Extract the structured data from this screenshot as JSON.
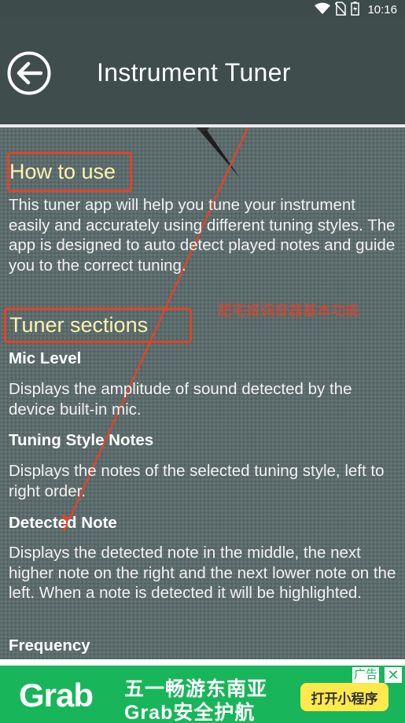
{
  "status_bar": {
    "time": "10:16"
  },
  "header": {
    "title": "Instrument Tuner",
    "back_icon": "back-arrow-icon"
  },
  "content": {
    "how_to_use_title": "How to use",
    "how_to_use_text": "This tuner app will help you tune your instrument easily and accurately using different tuning styles. The app is designed to auto detect played notes and guide you to the correct tuning.",
    "tuner_sections_title": "Tuner sections",
    "annotation": "肥宅姬调音器基本功能",
    "sections": [
      {
        "label": "Mic Level",
        "text": "Displays the amplitude of sound detected by the device built-in mic."
      },
      {
        "label": "Tuning Style Notes",
        "text": "Displays the notes of the selected tuning style, left to right order."
      },
      {
        "label": "Detected Note",
        "text": "Displays the detected note in the middle, the next higher note on the right and the next lower note on the left. When a note is detected it will be highlighted."
      },
      {
        "label": "Frequency",
        "text": ""
      }
    ]
  },
  "ad": {
    "brand": "Grab",
    "line1": "五一畅游东南亚",
    "line2": "Grab安全护航",
    "cta": "打开小程序",
    "tag": "广告",
    "close": "✕",
    "color": "#19b55a"
  },
  "colors": {
    "accent_red": "#e0442c",
    "title_yellow": "#fff2b0",
    "app_bar": "#3f4d4d"
  }
}
